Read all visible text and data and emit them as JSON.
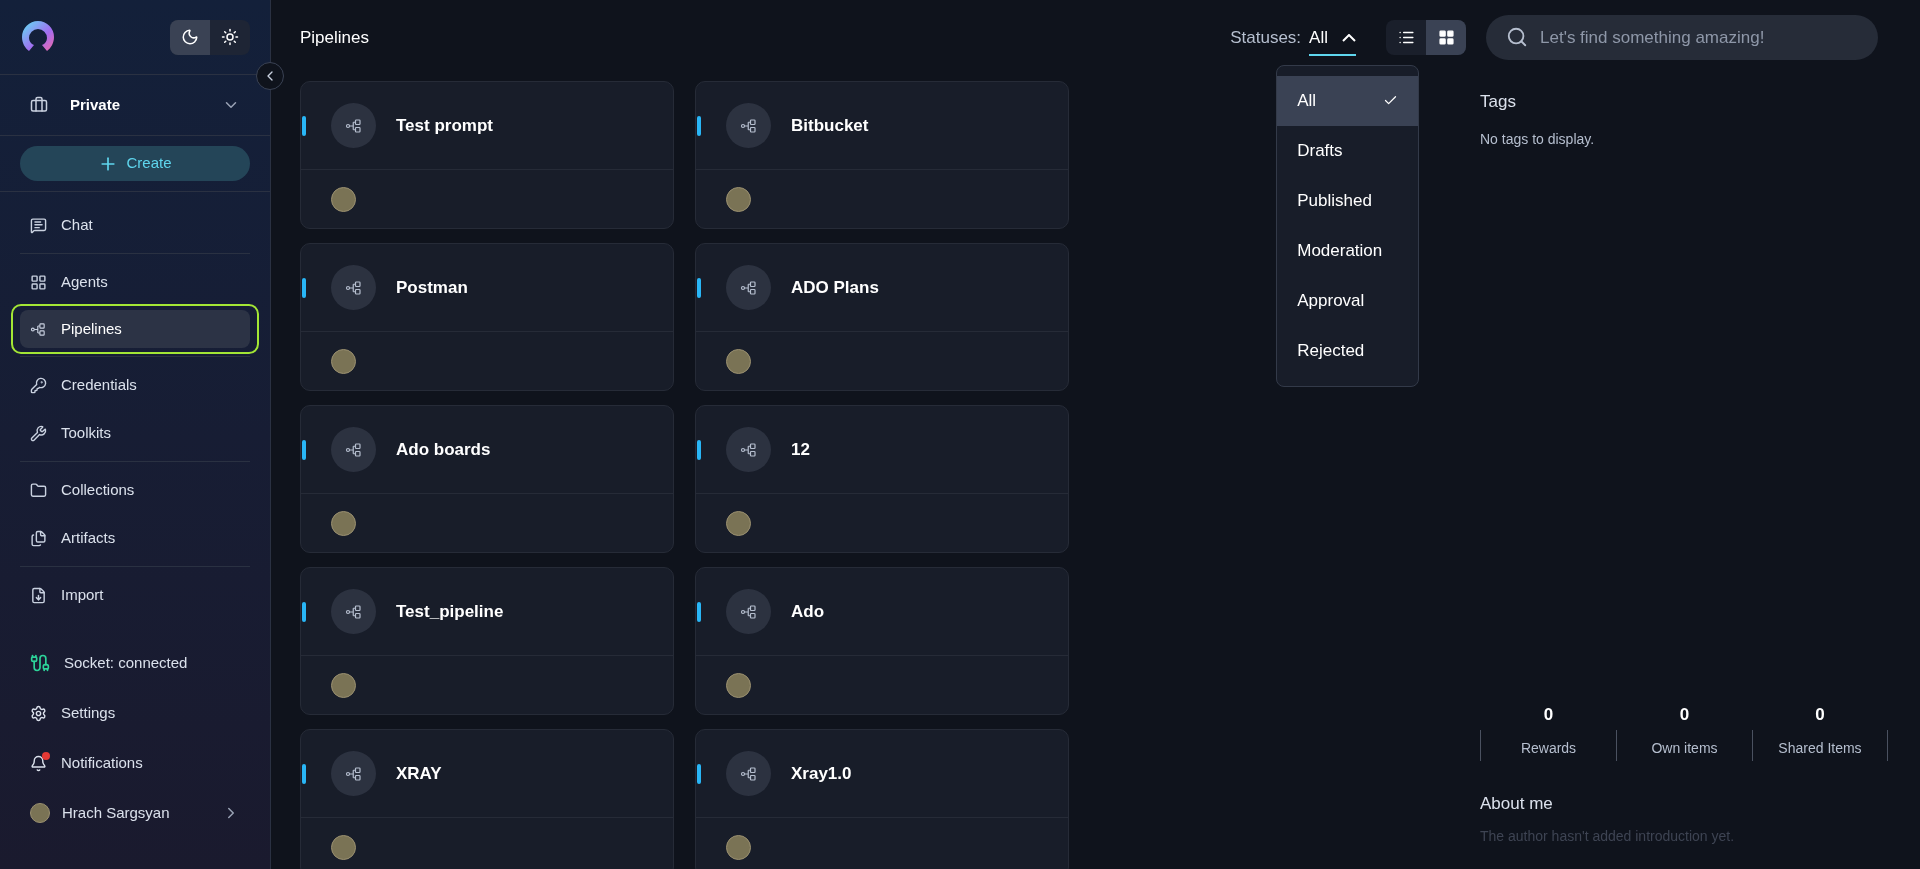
{
  "theme_toggle": [
    {
      "kind": "dark",
      "selected": true
    },
    {
      "kind": "light",
      "selected": false
    }
  ],
  "workspace": {
    "label": "Private"
  },
  "create_button": {
    "label": "Create"
  },
  "nav_groups": [
    [
      {
        "label": "Chat",
        "selected": false
      }
    ],
    [
      {
        "label": "Agents",
        "selected": false
      },
      {
        "label": "Pipelines",
        "selected": true
      }
    ],
    [
      {
        "label": "Credentials",
        "selected": false
      },
      {
        "label": "Toolkits",
        "selected": false
      }
    ],
    [
      {
        "label": "Collections",
        "selected": false
      },
      {
        "label": "Artifacts",
        "selected": false
      }
    ],
    [
      {
        "label": "Import",
        "selected": false
      }
    ]
  ],
  "socket_status": {
    "label": "Socket: connected"
  },
  "footer_items": [
    {
      "kind": "settings",
      "label": "Settings",
      "unread": false
    },
    {
      "kind": "notifications",
      "label": "Notifications",
      "unread": true
    }
  ],
  "user": {
    "name": "Hrach Sargsyan"
  },
  "page_title": "Pipelines",
  "status_filter": {
    "label": "Statuses:",
    "value": "All",
    "expanded": true,
    "options": [
      {
        "label": "All",
        "selected": true
      },
      {
        "label": "Drafts",
        "selected": false
      },
      {
        "label": "Published",
        "selected": false
      },
      {
        "label": "Moderation",
        "selected": false
      },
      {
        "label": "Approval",
        "selected": false
      },
      {
        "label": "Rejected",
        "selected": false
      }
    ]
  },
  "view_modes": [
    {
      "kind": "list",
      "selected": false
    },
    {
      "kind": "grid",
      "selected": true
    }
  ],
  "cards": [
    {
      "title": "Test prompt"
    },
    {
      "title": "Bitbucket"
    },
    {
      "title": "Postman"
    },
    {
      "title": "ADO Plans"
    },
    {
      "title": "Ado boards"
    },
    {
      "title": "12"
    },
    {
      "title": "Test_pipeline"
    },
    {
      "title": "Ado"
    },
    {
      "title": "XRAY"
    },
    {
      "title": "Xray1.0"
    }
  ],
  "search": {
    "placeholder": "Let's find something amazing!"
  },
  "tags": {
    "title": "Tags",
    "empty_text": "No tags to display."
  },
  "stats": [
    {
      "value": "0",
      "label": "Rewards"
    },
    {
      "value": "0",
      "label": "Own items"
    },
    {
      "value": "0",
      "label": "Shared Items"
    }
  ],
  "about": {
    "title": "About me",
    "text": "The author hasn't added introduction yet."
  }
}
